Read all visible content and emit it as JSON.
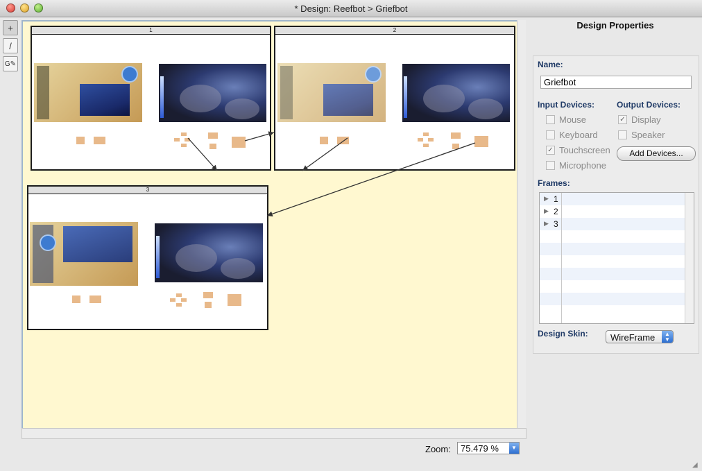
{
  "window": {
    "title": "* Design: Reefbot > Griefbot"
  },
  "tools": [
    {
      "name": "pointer-tool",
      "glyph": "+"
    },
    {
      "name": "pen-tool",
      "glyph": "/"
    },
    {
      "name": "gesture-tool",
      "glyph": "G✎"
    }
  ],
  "canvas": {
    "frames": [
      {
        "label": "1"
      },
      {
        "label": "2"
      },
      {
        "label": "3"
      }
    ]
  },
  "panel": {
    "title": "Design Properties",
    "name_label": "Name:",
    "name_value": "Griefbot",
    "input_devices_label": "Input Devices:",
    "output_devices_label": "Output Devices:",
    "input_devices": [
      {
        "label": "Mouse",
        "checked": false
      },
      {
        "label": "Keyboard",
        "checked": false
      },
      {
        "label": "Touchscreen",
        "checked": true
      },
      {
        "label": "Microphone",
        "checked": false
      }
    ],
    "output_devices": [
      {
        "label": "Display",
        "checked": true
      },
      {
        "label": "Speaker",
        "checked": false
      }
    ],
    "add_devices_label": "Add Devices...",
    "frames_label": "Frames:",
    "frames_list": [
      "1",
      "2",
      "3"
    ],
    "design_skin_label": "Design Skin:",
    "design_skin_value": "WireFrame"
  },
  "zoom": {
    "label": "Zoom:",
    "value": "75.479 %"
  }
}
